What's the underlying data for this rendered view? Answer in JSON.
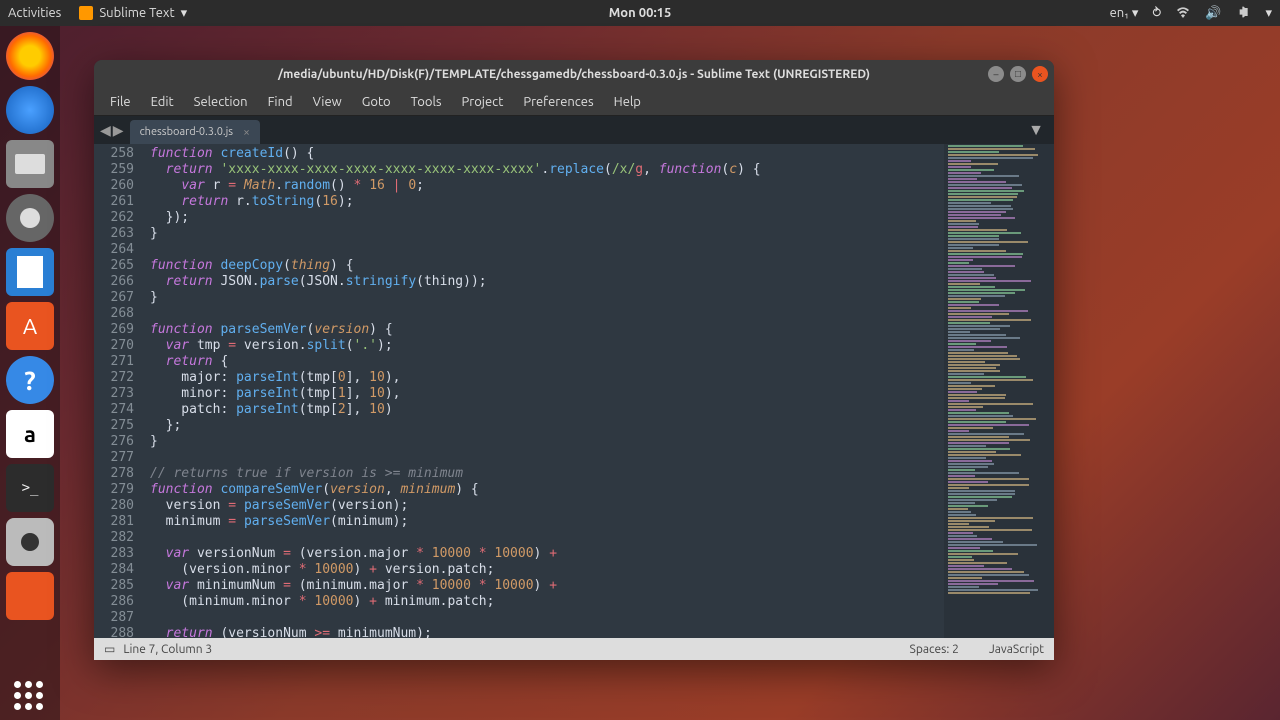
{
  "topbar": {
    "activities": "Activities",
    "app_name": "Sublime Text",
    "clock": "Mon 00:15",
    "lang": "en₁"
  },
  "dock": {
    "items": [
      "firefox",
      "thunderbird",
      "files",
      "disks",
      "writer",
      "software",
      "help",
      "amazon",
      "terminal",
      "camera",
      "ubuntu"
    ]
  },
  "window": {
    "title": "/media/ubuntu/HD/Disk(F)/TEMPLATE/chessgamedb/chessboard-0.3.0.js - Sublime Text (UNREGISTERED)"
  },
  "menu": [
    "File",
    "Edit",
    "Selection",
    "Find",
    "View",
    "Goto",
    "Tools",
    "Project",
    "Preferences",
    "Help"
  ],
  "tab": {
    "name": "chessboard-0.3.0.js"
  },
  "lines": {
    "start": 258,
    "count": 31
  },
  "code": [
    [
      [
        "kw",
        "function"
      ],
      [
        "prop",
        " "
      ],
      [
        "fn",
        "createId"
      ],
      [
        "prop",
        "() {"
      ]
    ],
    [
      [
        "prop",
        "  "
      ],
      [
        "kw2",
        "return"
      ],
      [
        "prop",
        " "
      ],
      [
        "str",
        "'xxxx-xxxx-xxxx-xxxx-xxxx-xxxx-xxxx-xxxx'"
      ],
      [
        "prop",
        "."
      ],
      [
        "fn",
        "replace"
      ],
      [
        "prop",
        "("
      ],
      [
        "re",
        "/x/"
      ],
      [
        "reflag",
        "g"
      ],
      [
        "prop",
        ", "
      ],
      [
        "kw",
        "function"
      ],
      [
        "prop",
        "("
      ],
      [
        "param",
        "c"
      ],
      [
        "prop",
        ") {"
      ]
    ],
    [
      [
        "prop",
        "    "
      ],
      [
        "kw2",
        "var"
      ],
      [
        "prop",
        " r "
      ],
      [
        "op",
        "="
      ],
      [
        "prop",
        " "
      ],
      [
        "param",
        "Math"
      ],
      [
        "prop",
        "."
      ],
      [
        "fn",
        "random"
      ],
      [
        "prop",
        "() "
      ],
      [
        "op",
        "*"
      ],
      [
        "prop",
        " "
      ],
      [
        "num",
        "16"
      ],
      [
        "prop",
        " "
      ],
      [
        "op",
        "|"
      ],
      [
        "prop",
        " "
      ],
      [
        "num",
        "0"
      ],
      [
        "prop",
        ";"
      ]
    ],
    [
      [
        "prop",
        "    "
      ],
      [
        "kw2",
        "return"
      ],
      [
        "prop",
        " r."
      ],
      [
        "fn",
        "toString"
      ],
      [
        "prop",
        "("
      ],
      [
        "num",
        "16"
      ],
      [
        "prop",
        ");"
      ]
    ],
    [
      [
        "prop",
        "  });"
      ]
    ],
    [
      [
        "prop",
        "}"
      ]
    ],
    [
      [
        "prop",
        ""
      ]
    ],
    [
      [
        "kw",
        "function"
      ],
      [
        "prop",
        " "
      ],
      [
        "fn",
        "deepCopy"
      ],
      [
        "prop",
        "("
      ],
      [
        "param",
        "thing"
      ],
      [
        "prop",
        ") {"
      ]
    ],
    [
      [
        "prop",
        "  "
      ],
      [
        "kw2",
        "return"
      ],
      [
        "prop",
        " JSON."
      ],
      [
        "fn",
        "parse"
      ],
      [
        "prop",
        "(JSON."
      ],
      [
        "fn",
        "stringify"
      ],
      [
        "prop",
        "(thing));"
      ]
    ],
    [
      [
        "prop",
        "}"
      ]
    ],
    [
      [
        "prop",
        ""
      ]
    ],
    [
      [
        "kw",
        "function"
      ],
      [
        "prop",
        " "
      ],
      [
        "fn",
        "parseSemVer"
      ],
      [
        "prop",
        "("
      ],
      [
        "param",
        "version"
      ],
      [
        "prop",
        ") {"
      ]
    ],
    [
      [
        "prop",
        "  "
      ],
      [
        "kw2",
        "var"
      ],
      [
        "prop",
        " tmp "
      ],
      [
        "op",
        "="
      ],
      [
        "prop",
        " version."
      ],
      [
        "fn",
        "split"
      ],
      [
        "prop",
        "("
      ],
      [
        "str",
        "'.'"
      ],
      [
        "prop",
        ");"
      ]
    ],
    [
      [
        "prop",
        "  "
      ],
      [
        "kw2",
        "return"
      ],
      [
        "prop",
        " {"
      ]
    ],
    [
      [
        "prop",
        "    major: "
      ],
      [
        "fn",
        "parseInt"
      ],
      [
        "prop",
        "(tmp["
      ],
      [
        "num",
        "0"
      ],
      [
        "prop",
        "], "
      ],
      [
        "num",
        "10"
      ],
      [
        "prop",
        "),"
      ]
    ],
    [
      [
        "prop",
        "    minor: "
      ],
      [
        "fn",
        "parseInt"
      ],
      [
        "prop",
        "(tmp["
      ],
      [
        "num",
        "1"
      ],
      [
        "prop",
        "], "
      ],
      [
        "num",
        "10"
      ],
      [
        "prop",
        "),"
      ]
    ],
    [
      [
        "prop",
        "    patch: "
      ],
      [
        "fn",
        "parseInt"
      ],
      [
        "prop",
        "(tmp["
      ],
      [
        "num",
        "2"
      ],
      [
        "prop",
        "], "
      ],
      [
        "num",
        "10"
      ],
      [
        "prop",
        ")"
      ]
    ],
    [
      [
        "prop",
        "  };"
      ]
    ],
    [
      [
        "prop",
        "}"
      ]
    ],
    [
      [
        "prop",
        ""
      ]
    ],
    [
      [
        "cmt",
        "// returns true if version is >= minimum"
      ]
    ],
    [
      [
        "kw",
        "function"
      ],
      [
        "prop",
        " "
      ],
      [
        "fn",
        "compareSemVer"
      ],
      [
        "prop",
        "("
      ],
      [
        "param",
        "version"
      ],
      [
        "prop",
        ", "
      ],
      [
        "param",
        "minimum"
      ],
      [
        "prop",
        ") {"
      ]
    ],
    [
      [
        "prop",
        "  version "
      ],
      [
        "op",
        "="
      ],
      [
        "prop",
        " "
      ],
      [
        "fn",
        "parseSemVer"
      ],
      [
        "prop",
        "(version);"
      ]
    ],
    [
      [
        "prop",
        "  minimum "
      ],
      [
        "op",
        "="
      ],
      [
        "prop",
        " "
      ],
      [
        "fn",
        "parseSemVer"
      ],
      [
        "prop",
        "(minimum);"
      ]
    ],
    [
      [
        "prop",
        ""
      ]
    ],
    [
      [
        "prop",
        "  "
      ],
      [
        "kw2",
        "var"
      ],
      [
        "prop",
        " versionNum "
      ],
      [
        "op",
        "="
      ],
      [
        "prop",
        " (version.major "
      ],
      [
        "op",
        "*"
      ],
      [
        "prop",
        " "
      ],
      [
        "num",
        "10000"
      ],
      [
        "prop",
        " "
      ],
      [
        "op",
        "*"
      ],
      [
        "prop",
        " "
      ],
      [
        "num",
        "10000"
      ],
      [
        "prop",
        ") "
      ],
      [
        "op",
        "+"
      ]
    ],
    [
      [
        "prop",
        "    (version.minor "
      ],
      [
        "op",
        "*"
      ],
      [
        "prop",
        " "
      ],
      [
        "num",
        "10000"
      ],
      [
        "prop",
        ") "
      ],
      [
        "op",
        "+"
      ],
      [
        "prop",
        " version.patch;"
      ]
    ],
    [
      [
        "prop",
        "  "
      ],
      [
        "kw2",
        "var"
      ],
      [
        "prop",
        " minimumNum "
      ],
      [
        "op",
        "="
      ],
      [
        "prop",
        " (minimum.major "
      ],
      [
        "op",
        "*"
      ],
      [
        "prop",
        " "
      ],
      [
        "num",
        "10000"
      ],
      [
        "prop",
        " "
      ],
      [
        "op",
        "*"
      ],
      [
        "prop",
        " "
      ],
      [
        "num",
        "10000"
      ],
      [
        "prop",
        ") "
      ],
      [
        "op",
        "+"
      ]
    ],
    [
      [
        "prop",
        "    (minimum.minor "
      ],
      [
        "op",
        "*"
      ],
      [
        "prop",
        " "
      ],
      [
        "num",
        "10000"
      ],
      [
        "prop",
        ") "
      ],
      [
        "op",
        "+"
      ],
      [
        "prop",
        " minimum.patch;"
      ]
    ],
    [
      [
        "prop",
        ""
      ]
    ],
    [
      [
        "prop",
        "  "
      ],
      [
        "kw2",
        "return"
      ],
      [
        "prop",
        " (versionNum "
      ],
      [
        "op",
        ">="
      ],
      [
        "prop",
        " minimumNum);"
      ]
    ]
  ],
  "statusbar": {
    "position": "Line 7, Column 3",
    "spaces": "Spaces: 2",
    "syntax": "JavaScript"
  }
}
